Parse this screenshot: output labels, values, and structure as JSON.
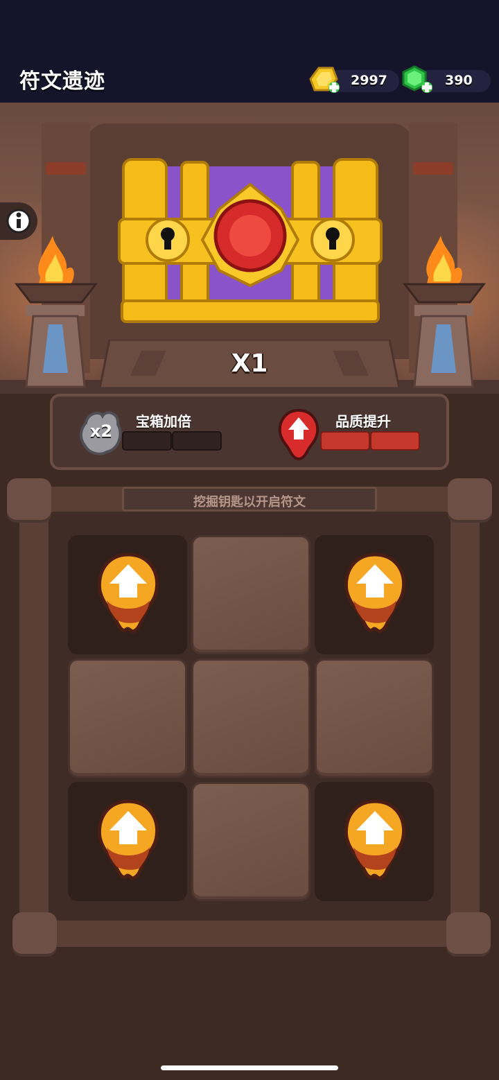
{
  "header": {
    "title": "符文遗迹",
    "gold": {
      "icon": "gold-coin-icon",
      "value": "2997"
    },
    "gems": {
      "icon": "green-gem-icon",
      "value": "390"
    }
  },
  "chest": {
    "multiplier": "X1"
  },
  "bonus_panel": {
    "chest_multiply": {
      "badge": "x2",
      "label": "宝箱加倍",
      "progress_filled": 0,
      "progress_total": 2
    },
    "quality_up": {
      "label": "品质提升",
      "progress_filled": 2,
      "progress_total": 2
    }
  },
  "board": {
    "hint": "挖掘钥匙以开启符文",
    "cells": [
      {
        "state": "dug",
        "item": "upgrade-arrow"
      },
      {
        "state": "stone"
      },
      {
        "state": "dug",
        "item": "upgrade-arrow"
      },
      {
        "state": "stone"
      },
      {
        "state": "stone"
      },
      {
        "state": "stone"
      },
      {
        "state": "dug",
        "item": "upgrade-arrow"
      },
      {
        "state": "stone"
      },
      {
        "state": "dug",
        "item": "upgrade-arrow"
      }
    ]
  },
  "colors": {
    "header_bg": "#15142a",
    "gold": "#f5c021",
    "gem": "#33d04a",
    "quality_red": "#c5392c",
    "orange_token": "#f5a623"
  }
}
